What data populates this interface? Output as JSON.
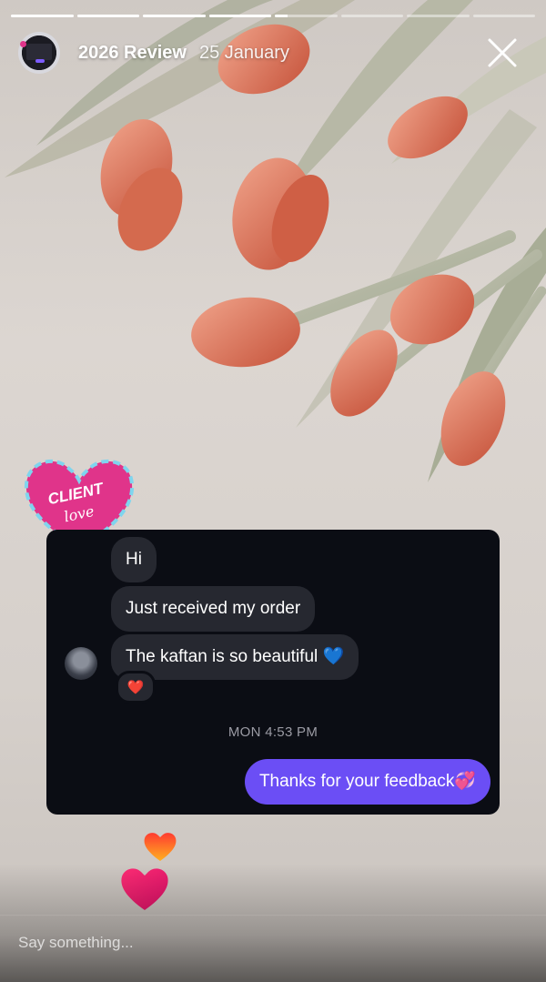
{
  "story": {
    "title": "2026 Review",
    "date": "25 January",
    "progress_segments": [
      1,
      1,
      1,
      1,
      0.2,
      0,
      0,
      0
    ],
    "close_icon": "close-icon"
  },
  "chat": {
    "incoming": [
      {
        "text": "Hi"
      },
      {
        "text": "Just received my order"
      },
      {
        "text": "The kaftan is so beautiful 💙"
      }
    ],
    "reaction": "❤️",
    "timestamp": "MON 4:53 PM",
    "outgoing": "Thanks for your feedback💞"
  },
  "sticker": {
    "line1": "CLIENT",
    "line2": "love"
  },
  "reply": {
    "placeholder": "Say something..."
  },
  "colors": {
    "accent_purple": "#6b4ef5",
    "sticker_pink": "#e0348a",
    "chat_bg": "#0b0d14"
  }
}
